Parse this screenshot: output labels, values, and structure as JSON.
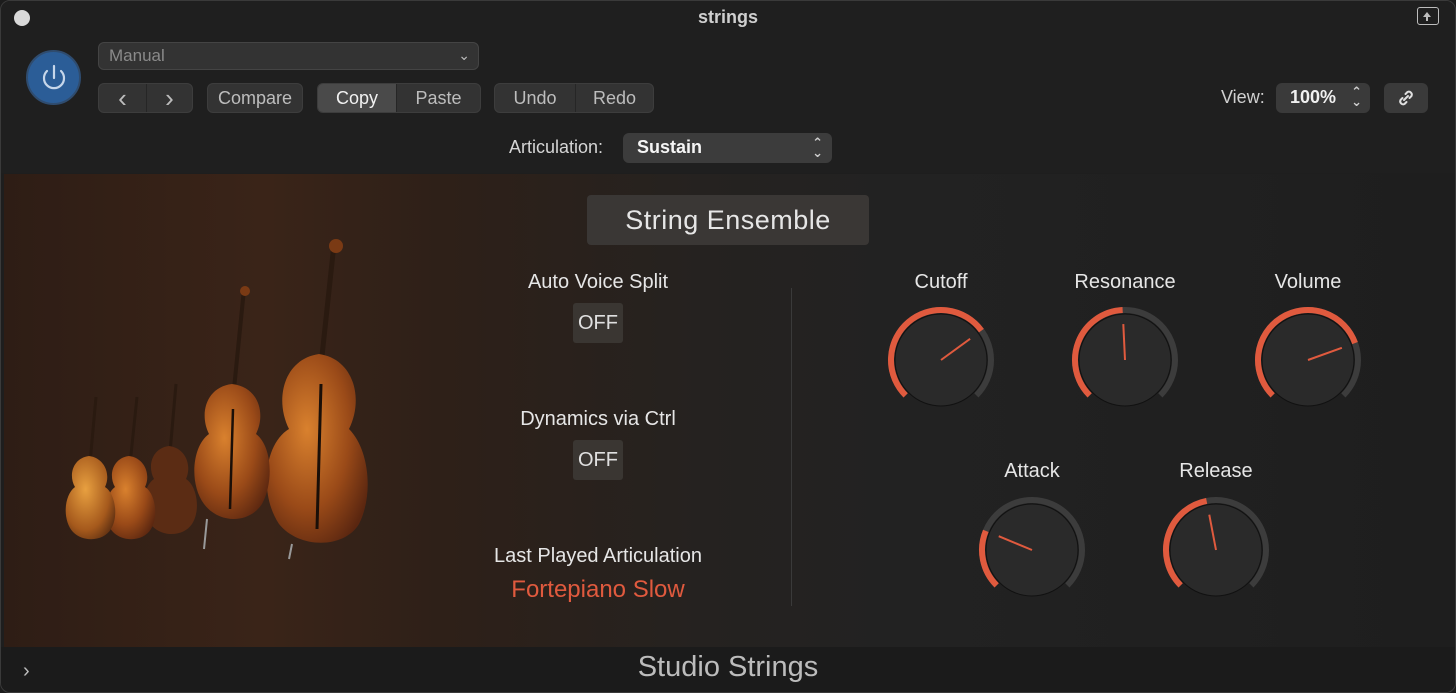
{
  "window": {
    "title": "strings"
  },
  "header": {
    "preset": "Manual",
    "buttons": {
      "prev": "‹",
      "next": "›",
      "compare": "Compare",
      "copy": "Copy",
      "paste": "Paste",
      "undo": "Undo",
      "redo": "Redo"
    },
    "view_label": "View:",
    "zoom": "100%",
    "articulation_label": "Articulation:",
    "articulation_value": "Sustain"
  },
  "instrument": {
    "name": "String Ensemble",
    "auto_voice_split_label": "Auto Voice Split",
    "auto_voice_split_value": "OFF",
    "dynamics_label": "Dynamics via Ctrl",
    "dynamics_value": "OFF",
    "last_played_label": "Last Played Articulation",
    "last_played_value": "Fortepiano Slow"
  },
  "knobs": [
    {
      "label": "Cutoff",
      "value_fraction": 0.7
    },
    {
      "label": "Resonance",
      "value_fraction": 0.49
    },
    {
      "label": "Volume",
      "value_fraction": 0.76
    },
    {
      "label": "Attack",
      "value_fraction": 0.25
    },
    {
      "label": "Release",
      "value_fraction": 0.46
    }
  ],
  "footer": {
    "title": "Studio Strings",
    "toggle": "›"
  },
  "colors": {
    "accent": "#e05a3e",
    "power": "#2b5d97"
  }
}
